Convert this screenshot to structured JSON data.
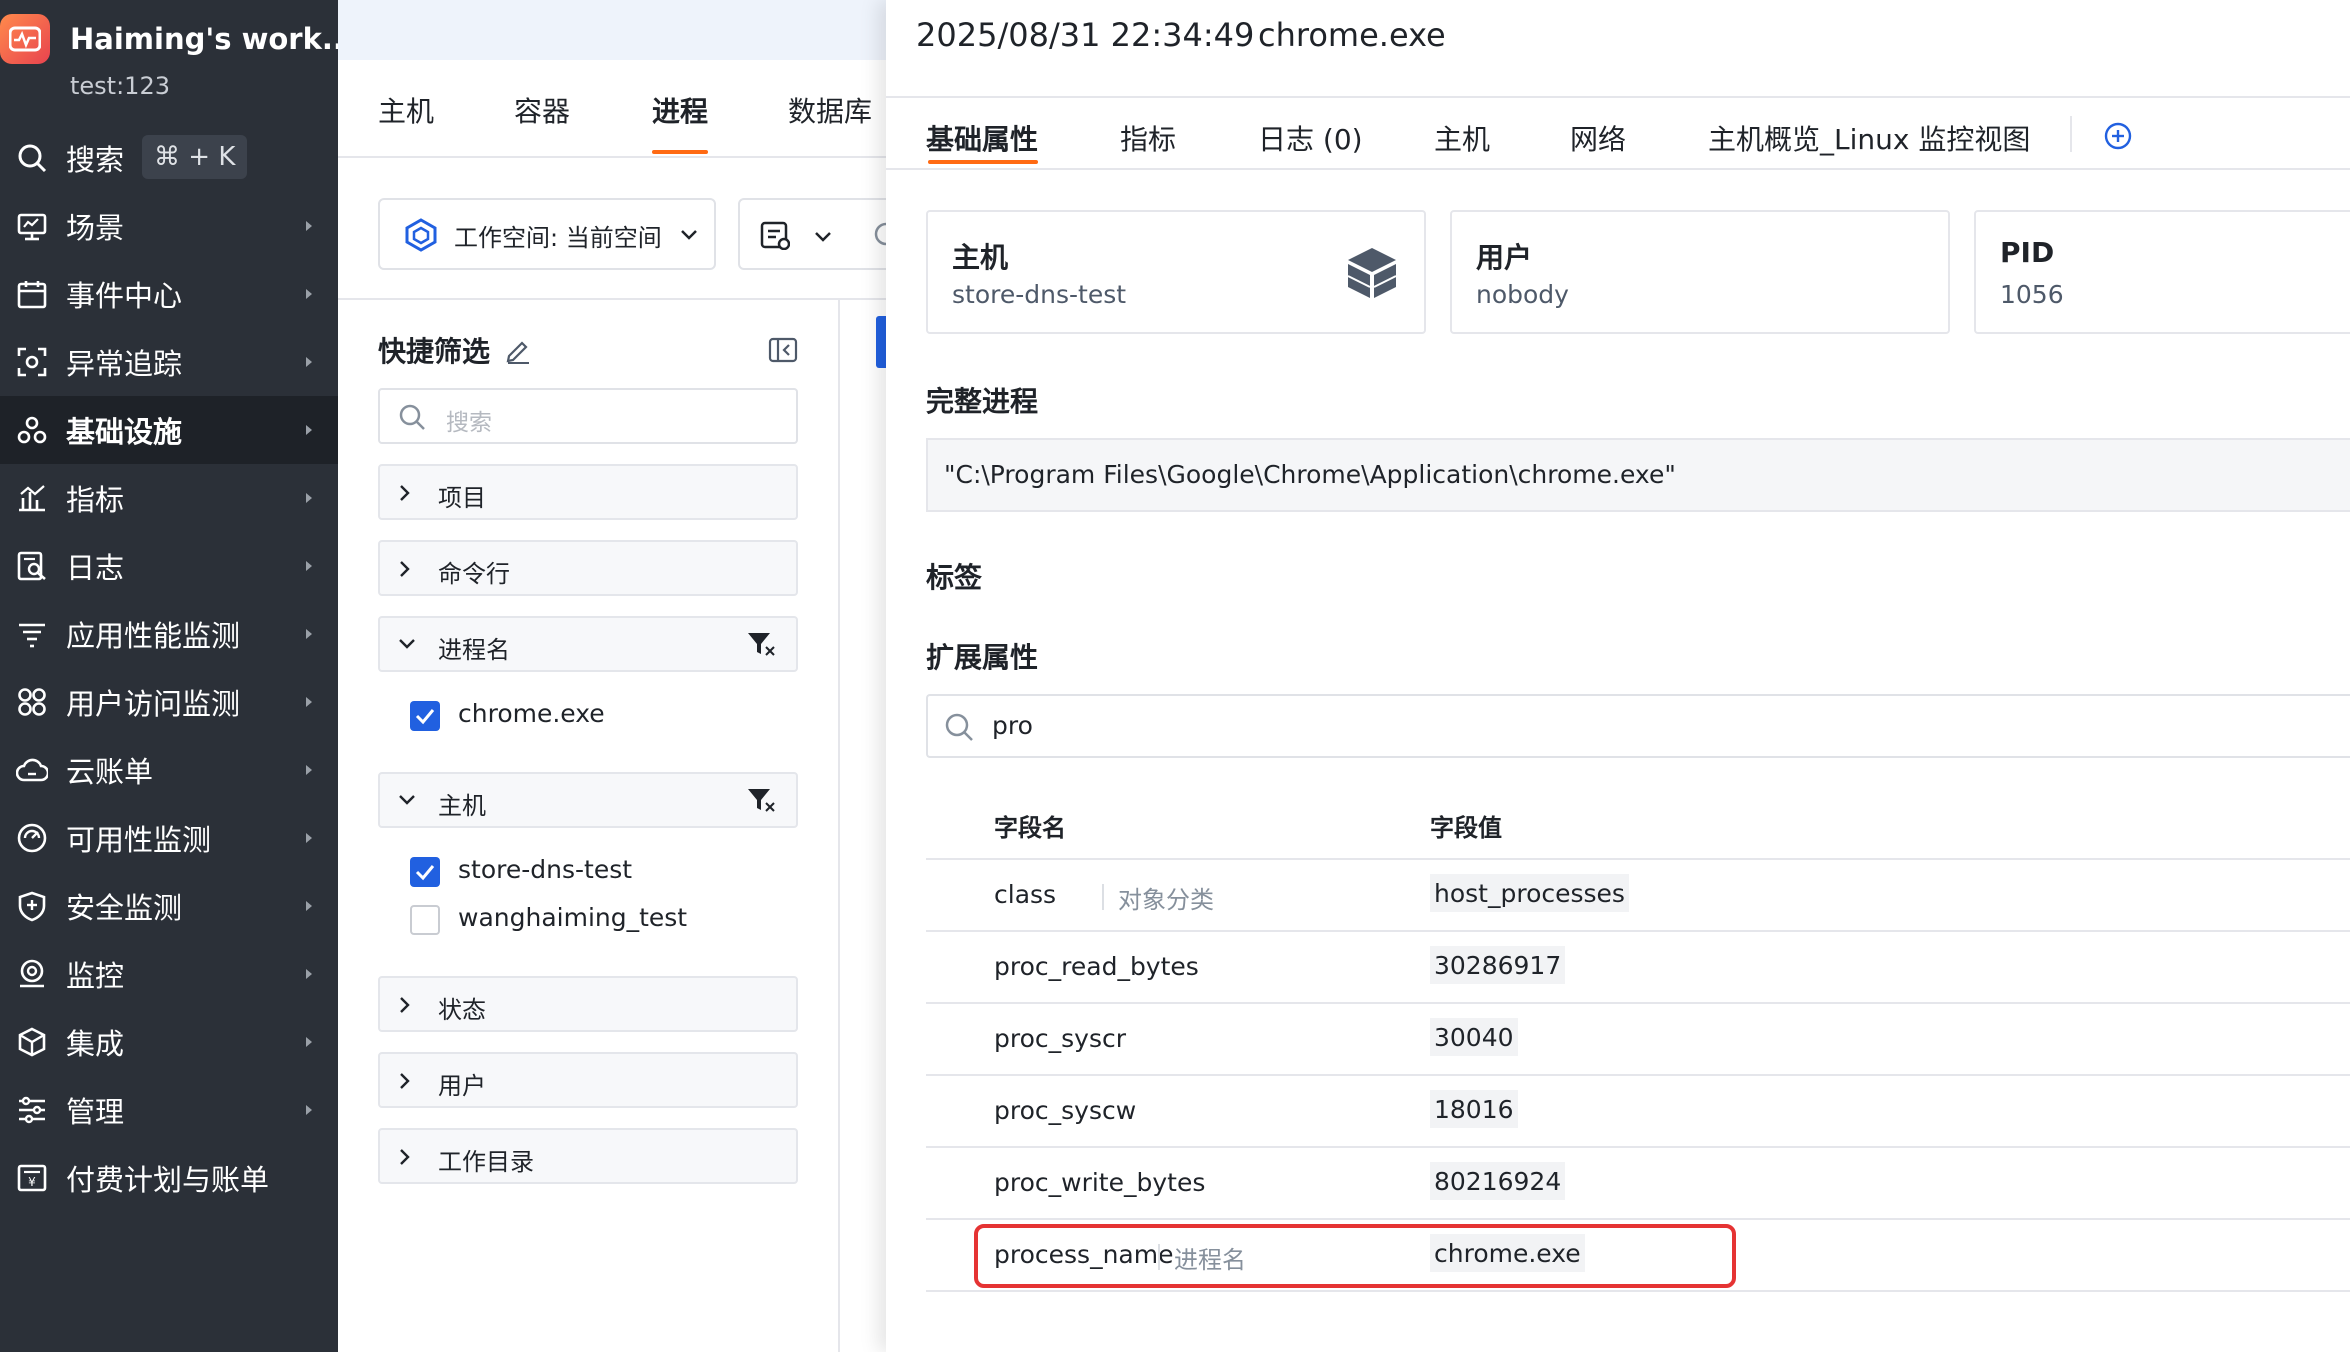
{
  "sidebar": {
    "workspace_name": "Haiming's work...",
    "account": "test:123",
    "search_label": "搜索",
    "search_shortcut": "⌘ + K",
    "items": [
      {
        "label": "场景",
        "icon": "monitor-icon"
      },
      {
        "label": "事件中心",
        "icon": "calendar-icon"
      },
      {
        "label": "异常追踪",
        "icon": "scan-icon"
      },
      {
        "label": "基础设施",
        "icon": "infrastructure-icon",
        "active": true
      },
      {
        "label": "指标",
        "icon": "chart-icon"
      },
      {
        "label": "日志",
        "icon": "log-search-icon"
      },
      {
        "label": "应用性能监测",
        "icon": "list-filter-icon"
      },
      {
        "label": "用户访问监测",
        "icon": "grid-circles-icon"
      },
      {
        "label": "云账单",
        "icon": "cloud-icon"
      },
      {
        "label": "可用性监测",
        "icon": "probe-icon"
      },
      {
        "label": "安全监测",
        "icon": "shield-icon"
      },
      {
        "label": "监控",
        "icon": "monitor-alert-icon"
      },
      {
        "label": "集成",
        "icon": "cube-icon"
      },
      {
        "label": "管理",
        "icon": "sliders-icon"
      },
      {
        "label": "付费计划与账单",
        "icon": "billing-icon"
      }
    ]
  },
  "middle": {
    "tabs": [
      "主机",
      "容器",
      "进程",
      "数据库"
    ],
    "active_tab": "进程",
    "workspace_select": "工作空间: 当前空间",
    "quick_filter_title": "快捷筛选",
    "filter_search_placeholder": "搜索",
    "facets": {
      "project": "项目",
      "cmdline": "命令行",
      "process_name": "进程名",
      "process_name_values": [
        {
          "label": "chrome.exe",
          "checked": true
        }
      ],
      "host": "主机",
      "host_values": [
        {
          "label": "store-dns-test",
          "checked": true
        },
        {
          "label": "wanghaiming_test",
          "checked": false
        }
      ],
      "state": "状态",
      "user": "用户",
      "workdir": "工作目录"
    }
  },
  "drawer": {
    "timestamp": "2025/08/31 22:34:49",
    "process": "chrome.exe",
    "tabs": [
      "基础属性",
      "指标",
      "日志 (0)",
      "主机",
      "网络",
      "主机概览_Linux 监控视图"
    ],
    "active_tab": "基础属性",
    "cards": [
      {
        "title": "主机",
        "value": "store-dns-test"
      },
      {
        "title": "用户",
        "value": "nobody"
      },
      {
        "title": "PID",
        "value": "1056"
      }
    ],
    "full_process_title": "完整进程",
    "full_process_value": "\"C:\\Program Files\\Google\\Chrome\\Application\\chrome.exe\"",
    "tags_title": "标签",
    "ext_title": "扩展属性",
    "ext_search_value": "pro",
    "table": {
      "headers": [
        "字段名",
        "字段值"
      ],
      "rows": [
        {
          "key": "class",
          "alias": "对象分类",
          "value": "host_processes"
        },
        {
          "key": "proc_read_bytes",
          "alias": "",
          "value": "30286917"
        },
        {
          "key": "proc_syscr",
          "alias": "",
          "value": "30040"
        },
        {
          "key": "proc_syscw",
          "alias": "",
          "value": "18016"
        },
        {
          "key": "proc_write_bytes",
          "alias": "",
          "value": "80216924"
        },
        {
          "key": "process_name",
          "alias": "进程名",
          "value": "chrome.exe",
          "highlighted": true
        }
      ]
    }
  },
  "colors": {
    "sidebar_bg": "#2b3038",
    "accent_orange": "#ff6a13",
    "checkbox_blue": "#2160e0",
    "highlight_red": "#e53333"
  }
}
